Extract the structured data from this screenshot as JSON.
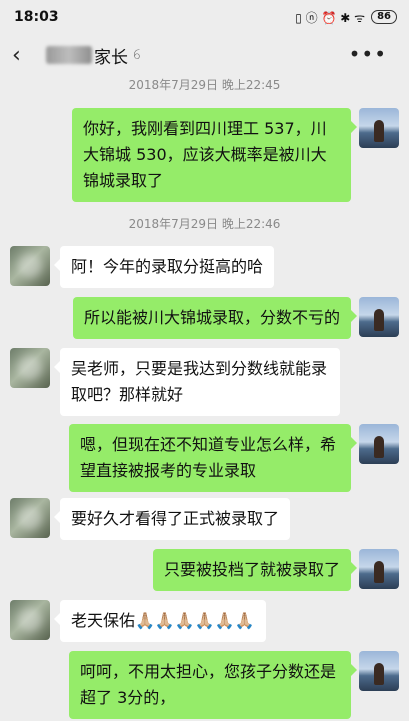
{
  "status": {
    "time": "18:03",
    "battery": "86",
    "signal_icons": "▯ ⓝ ⏰ ✱ ᯤ"
  },
  "header": {
    "title": "家长",
    "more_label": "•••"
  },
  "timestamps": [
    "2018年7月29日 晚上22:45",
    "2018年7月29日 晚上22:46"
  ],
  "messages": [
    {
      "side": "right",
      "text": "你好，我刚看到四川理工 537，川大锦城 530，应该大概率是被川大锦城录取了"
    },
    {
      "side": "left",
      "text": "阿！今年的录取分挺高的哈"
    },
    {
      "side": "right",
      "text": "所以能被川大锦城录取，分数不亏的"
    },
    {
      "side": "left",
      "text": "吴老师，只要是我达到分数线就能录取吧？那样就好"
    },
    {
      "side": "right",
      "text": "嗯，但现在还不知道专业怎么样，希望直接被报考的专业录取"
    },
    {
      "side": "left",
      "text": "要好久才看得了正式被录取了"
    },
    {
      "side": "right",
      "text": "只要被投档了就被录取了"
    },
    {
      "side": "left",
      "text": "老天保佑🙏🏼🙏🏼🙏🏼🙏🏼🙏🏼🙏🏼"
    },
    {
      "side": "right",
      "text": "呵呵，不用太担心，您孩子分数还是超了 3分的，"
    }
  ],
  "colors": {
    "background": "#ededed",
    "sent_bubble": "#95ec69",
    "received_bubble": "#ffffff"
  }
}
